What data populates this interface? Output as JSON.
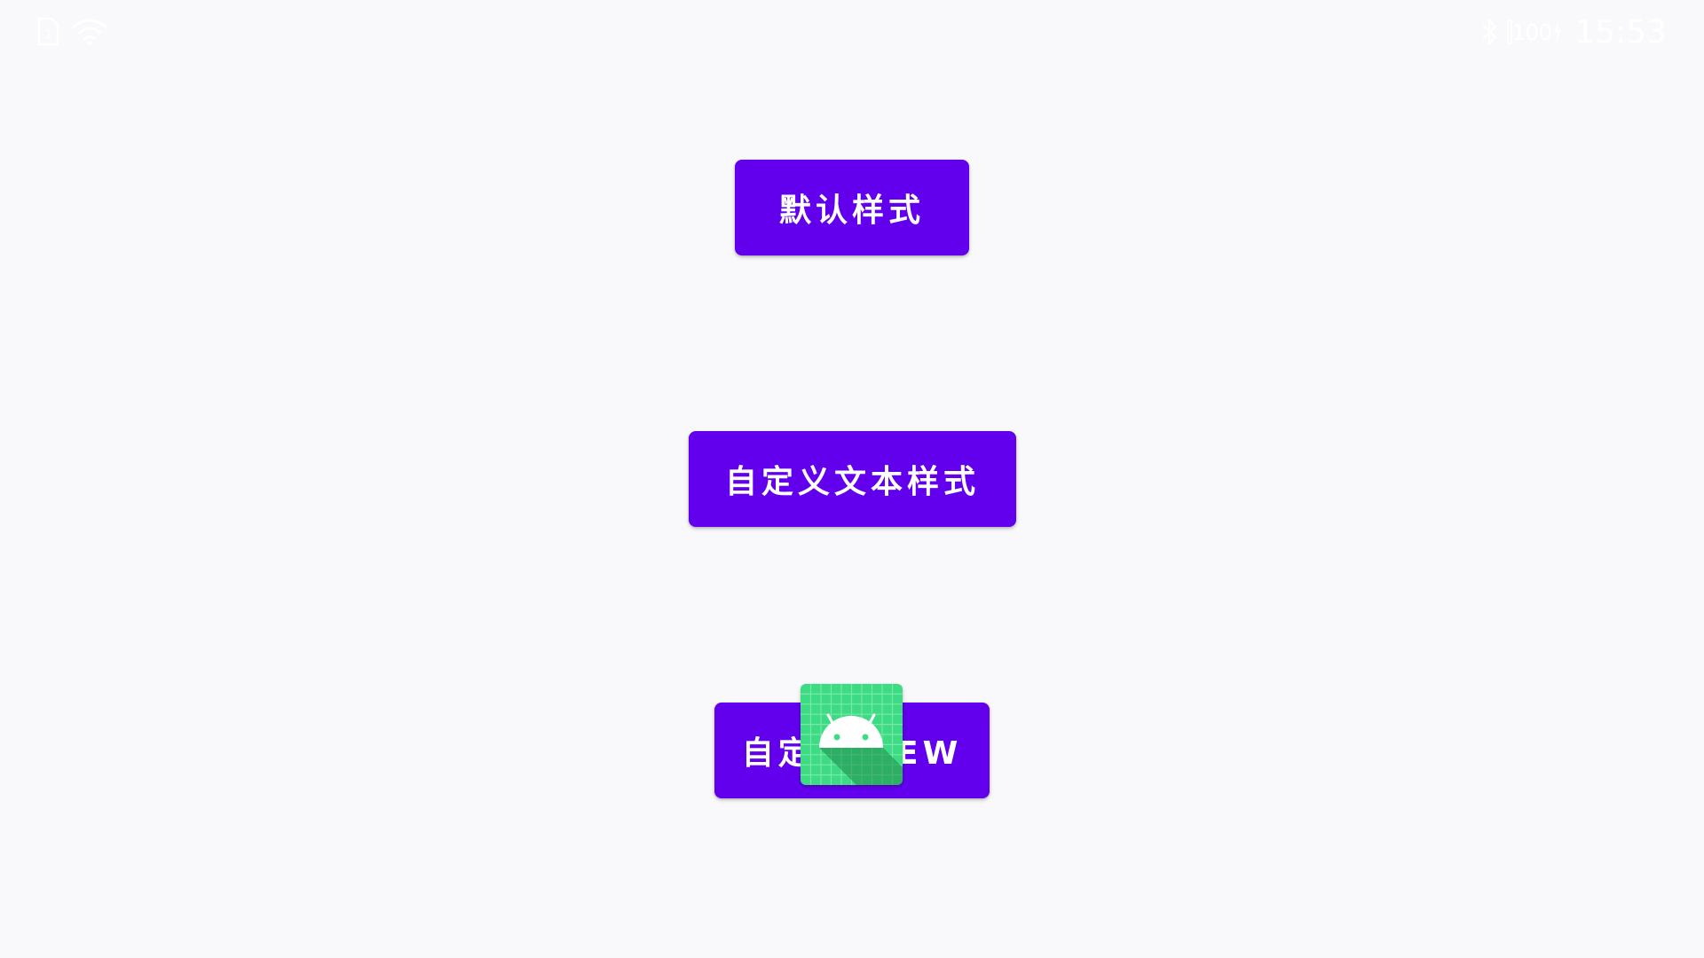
{
  "status_bar": {
    "left_icons": [
      "sim-card-icon",
      "wifi-icon"
    ],
    "right_icons": [
      "bluetooth-icon",
      "battery-icon"
    ],
    "battery_level": "100",
    "time": "15:53"
  },
  "buttons": {
    "default_style": "默认样式",
    "custom_text_style": "自定义文本样式",
    "custom_view": "自定义VIEW"
  },
  "overlay_icon": "android-launcher-icon",
  "colors": {
    "background": "#f9f9fb",
    "button": "#6200ee",
    "button_text": "#ffffff",
    "android_green": "#3ddc84"
  }
}
